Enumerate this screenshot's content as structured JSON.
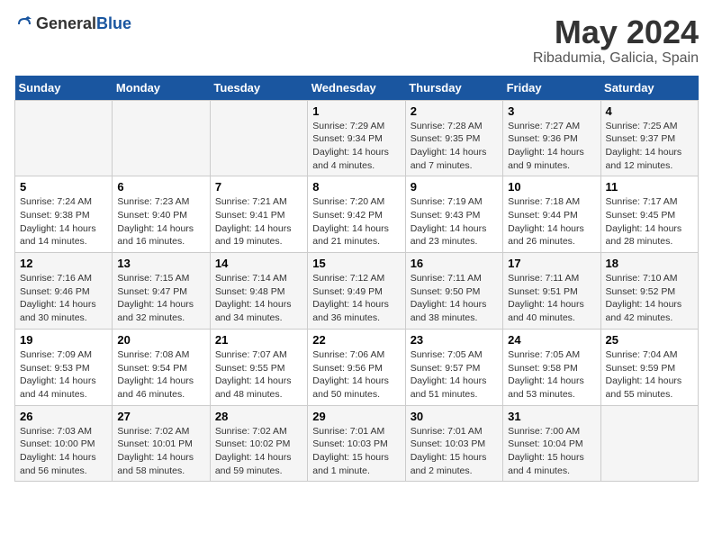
{
  "header": {
    "logo_general": "General",
    "logo_blue": "Blue",
    "title": "May 2024",
    "subtitle": "Ribadumia, Galicia, Spain"
  },
  "calendar": {
    "weekdays": [
      "Sunday",
      "Monday",
      "Tuesday",
      "Wednesday",
      "Thursday",
      "Friday",
      "Saturday"
    ],
    "rows": [
      [
        {
          "day": "",
          "info": ""
        },
        {
          "day": "",
          "info": ""
        },
        {
          "day": "",
          "info": ""
        },
        {
          "day": "1",
          "info": "Sunrise: 7:29 AM\nSunset: 9:34 PM\nDaylight: 14 hours\nand 4 minutes."
        },
        {
          "day": "2",
          "info": "Sunrise: 7:28 AM\nSunset: 9:35 PM\nDaylight: 14 hours\nand 7 minutes."
        },
        {
          "day": "3",
          "info": "Sunrise: 7:27 AM\nSunset: 9:36 PM\nDaylight: 14 hours\nand 9 minutes."
        },
        {
          "day": "4",
          "info": "Sunrise: 7:25 AM\nSunset: 9:37 PM\nDaylight: 14 hours\nand 12 minutes."
        }
      ],
      [
        {
          "day": "5",
          "info": "Sunrise: 7:24 AM\nSunset: 9:38 PM\nDaylight: 14 hours\nand 14 minutes."
        },
        {
          "day": "6",
          "info": "Sunrise: 7:23 AM\nSunset: 9:40 PM\nDaylight: 14 hours\nand 16 minutes."
        },
        {
          "day": "7",
          "info": "Sunrise: 7:21 AM\nSunset: 9:41 PM\nDaylight: 14 hours\nand 19 minutes."
        },
        {
          "day": "8",
          "info": "Sunrise: 7:20 AM\nSunset: 9:42 PM\nDaylight: 14 hours\nand 21 minutes."
        },
        {
          "day": "9",
          "info": "Sunrise: 7:19 AM\nSunset: 9:43 PM\nDaylight: 14 hours\nand 23 minutes."
        },
        {
          "day": "10",
          "info": "Sunrise: 7:18 AM\nSunset: 9:44 PM\nDaylight: 14 hours\nand 26 minutes."
        },
        {
          "day": "11",
          "info": "Sunrise: 7:17 AM\nSunset: 9:45 PM\nDaylight: 14 hours\nand 28 minutes."
        }
      ],
      [
        {
          "day": "12",
          "info": "Sunrise: 7:16 AM\nSunset: 9:46 PM\nDaylight: 14 hours\nand 30 minutes."
        },
        {
          "day": "13",
          "info": "Sunrise: 7:15 AM\nSunset: 9:47 PM\nDaylight: 14 hours\nand 32 minutes."
        },
        {
          "day": "14",
          "info": "Sunrise: 7:14 AM\nSunset: 9:48 PM\nDaylight: 14 hours\nand 34 minutes."
        },
        {
          "day": "15",
          "info": "Sunrise: 7:12 AM\nSunset: 9:49 PM\nDaylight: 14 hours\nand 36 minutes."
        },
        {
          "day": "16",
          "info": "Sunrise: 7:11 AM\nSunset: 9:50 PM\nDaylight: 14 hours\nand 38 minutes."
        },
        {
          "day": "17",
          "info": "Sunrise: 7:11 AM\nSunset: 9:51 PM\nDaylight: 14 hours\nand 40 minutes."
        },
        {
          "day": "18",
          "info": "Sunrise: 7:10 AM\nSunset: 9:52 PM\nDaylight: 14 hours\nand 42 minutes."
        }
      ],
      [
        {
          "day": "19",
          "info": "Sunrise: 7:09 AM\nSunset: 9:53 PM\nDaylight: 14 hours\nand 44 minutes."
        },
        {
          "day": "20",
          "info": "Sunrise: 7:08 AM\nSunset: 9:54 PM\nDaylight: 14 hours\nand 46 minutes."
        },
        {
          "day": "21",
          "info": "Sunrise: 7:07 AM\nSunset: 9:55 PM\nDaylight: 14 hours\nand 48 minutes."
        },
        {
          "day": "22",
          "info": "Sunrise: 7:06 AM\nSunset: 9:56 PM\nDaylight: 14 hours\nand 50 minutes."
        },
        {
          "day": "23",
          "info": "Sunrise: 7:05 AM\nSunset: 9:57 PM\nDaylight: 14 hours\nand 51 minutes."
        },
        {
          "day": "24",
          "info": "Sunrise: 7:05 AM\nSunset: 9:58 PM\nDaylight: 14 hours\nand 53 minutes."
        },
        {
          "day": "25",
          "info": "Sunrise: 7:04 AM\nSunset: 9:59 PM\nDaylight: 14 hours\nand 55 minutes."
        }
      ],
      [
        {
          "day": "26",
          "info": "Sunrise: 7:03 AM\nSunset: 10:00 PM\nDaylight: 14 hours\nand 56 minutes."
        },
        {
          "day": "27",
          "info": "Sunrise: 7:02 AM\nSunset: 10:01 PM\nDaylight: 14 hours\nand 58 minutes."
        },
        {
          "day": "28",
          "info": "Sunrise: 7:02 AM\nSunset: 10:02 PM\nDaylight: 14 hours\nand 59 minutes."
        },
        {
          "day": "29",
          "info": "Sunrise: 7:01 AM\nSunset: 10:03 PM\nDaylight: 15 hours\nand 1 minute."
        },
        {
          "day": "30",
          "info": "Sunrise: 7:01 AM\nSunset: 10:03 PM\nDaylight: 15 hours\nand 2 minutes."
        },
        {
          "day": "31",
          "info": "Sunrise: 7:00 AM\nSunset: 10:04 PM\nDaylight: 15 hours\nand 4 minutes."
        },
        {
          "day": "",
          "info": ""
        }
      ]
    ]
  }
}
